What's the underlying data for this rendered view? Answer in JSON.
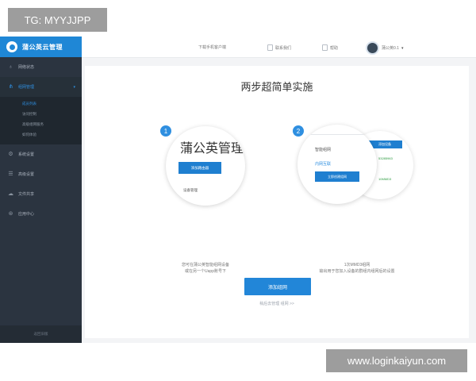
{
  "watermark_top": "TG: MYYJJPP",
  "watermark_bottom": "www.loginkaiyun.com",
  "sidebar": {
    "brand": "蒲公英云管理",
    "items": [
      {
        "label": "网络状态",
        "icon": "network-icon"
      },
      {
        "label": "组网管理",
        "icon": "share-icon",
        "active": true
      },
      {
        "label": "系统设置",
        "icon": "gear-icon"
      },
      {
        "label": "高级设置",
        "icon": "list-icon"
      },
      {
        "label": "文件共享",
        "icon": "cloud-icon"
      },
      {
        "label": "应用中心",
        "icon": "app-icon"
      }
    ],
    "subitems": [
      "成员列表",
      "访问控制",
      "高级组网服务",
      "如何体验"
    ],
    "footer": "返回旧版"
  },
  "header": {
    "download": "下载手机客户端",
    "contact": "联系我们",
    "help": "帮助",
    "user": "蒲公英0.1"
  },
  "main": {
    "title": "两步超简单实施",
    "step1": {
      "number": "1",
      "heading": "蒲公英管理",
      "button": "添加路由器",
      "label": "设备管理",
      "desc_line1": "您可在蒲公英智能组网设备",
      "desc_line2": "或在另一个Uapp账号下"
    },
    "step2": {
      "number": "2",
      "menu1": "智能组网",
      "menu2": "内网互联",
      "button": "立即创建组网",
      "tag": "添加设备",
      "code1": "53285963",
      "code2": "10MMD3",
      "desc_line1": "1次MMD3组网",
      "desc_line2": "输出用于您加入设备的群组内组网后的设置"
    },
    "button": "添加组网",
    "skip": "稍后去管理 组网 >>"
  }
}
